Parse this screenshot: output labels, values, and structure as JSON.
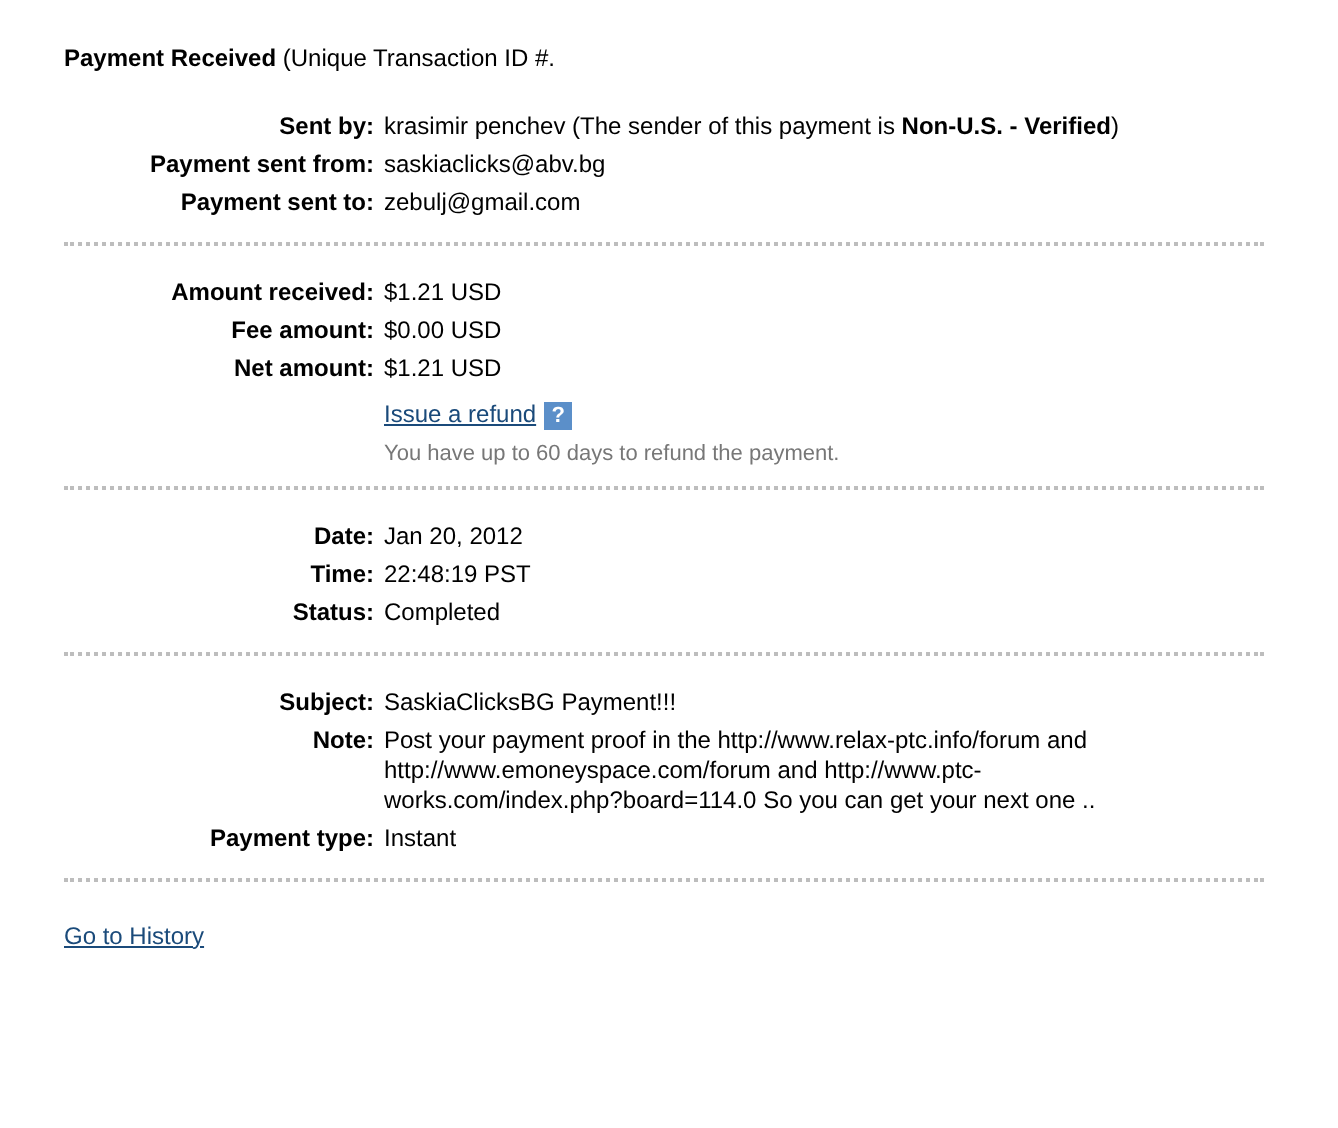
{
  "title": "**Payment Received** (Unique Transaction ID #.",
  "sections": [
    {
      "rows": [
        {
          "label": "Sent by:",
          "value": "krasimir penchev (The sender of this payment is **Non-U.S. - Verified**)"
        },
        {
          "label": "Payment sent from:",
          "value": "saskiaclicks@abv.bg"
        },
        {
          "label": "Payment sent to:",
          "value": "zebulj@gmail.com"
        }
      ]
    },
    {
      "rows": [
        {
          "label": "Amount received:",
          "value": "$1.21 USD"
        },
        {
          "label": "Fee amount:",
          "value": "$0.00 USD"
        },
        {
          "label": "Net amount:",
          "value": "$1.21 USD"
        }
      ],
      "refund": {
        "link": "Issue a refund",
        "help": "?",
        "hint": "You have up to 60 days to refund the payment."
      }
    },
    {
      "rows": [
        {
          "label": "Date:",
          "value": "Jan 20, 2012"
        },
        {
          "label": "Time:",
          "value": "22:48:19 PST"
        },
        {
          "label": "Status:",
          "value": "Completed"
        }
      ]
    },
    {
      "rows": [
        {
          "label": "Subject:",
          "value": "SaskiaClicksBG Payment!!!"
        },
        {
          "label": "Note:",
          "value": "Post your payment proof in the http://www.relax-ptc.info/forum and http://www.emoneyspace.com/forum and http://www.ptc-works.com/index.php?board=114.0 So you can get your next one .."
        },
        {
          "label": "Payment type:",
          "value": "Instant"
        }
      ]
    }
  ],
  "footer_link": "Go to History"
}
